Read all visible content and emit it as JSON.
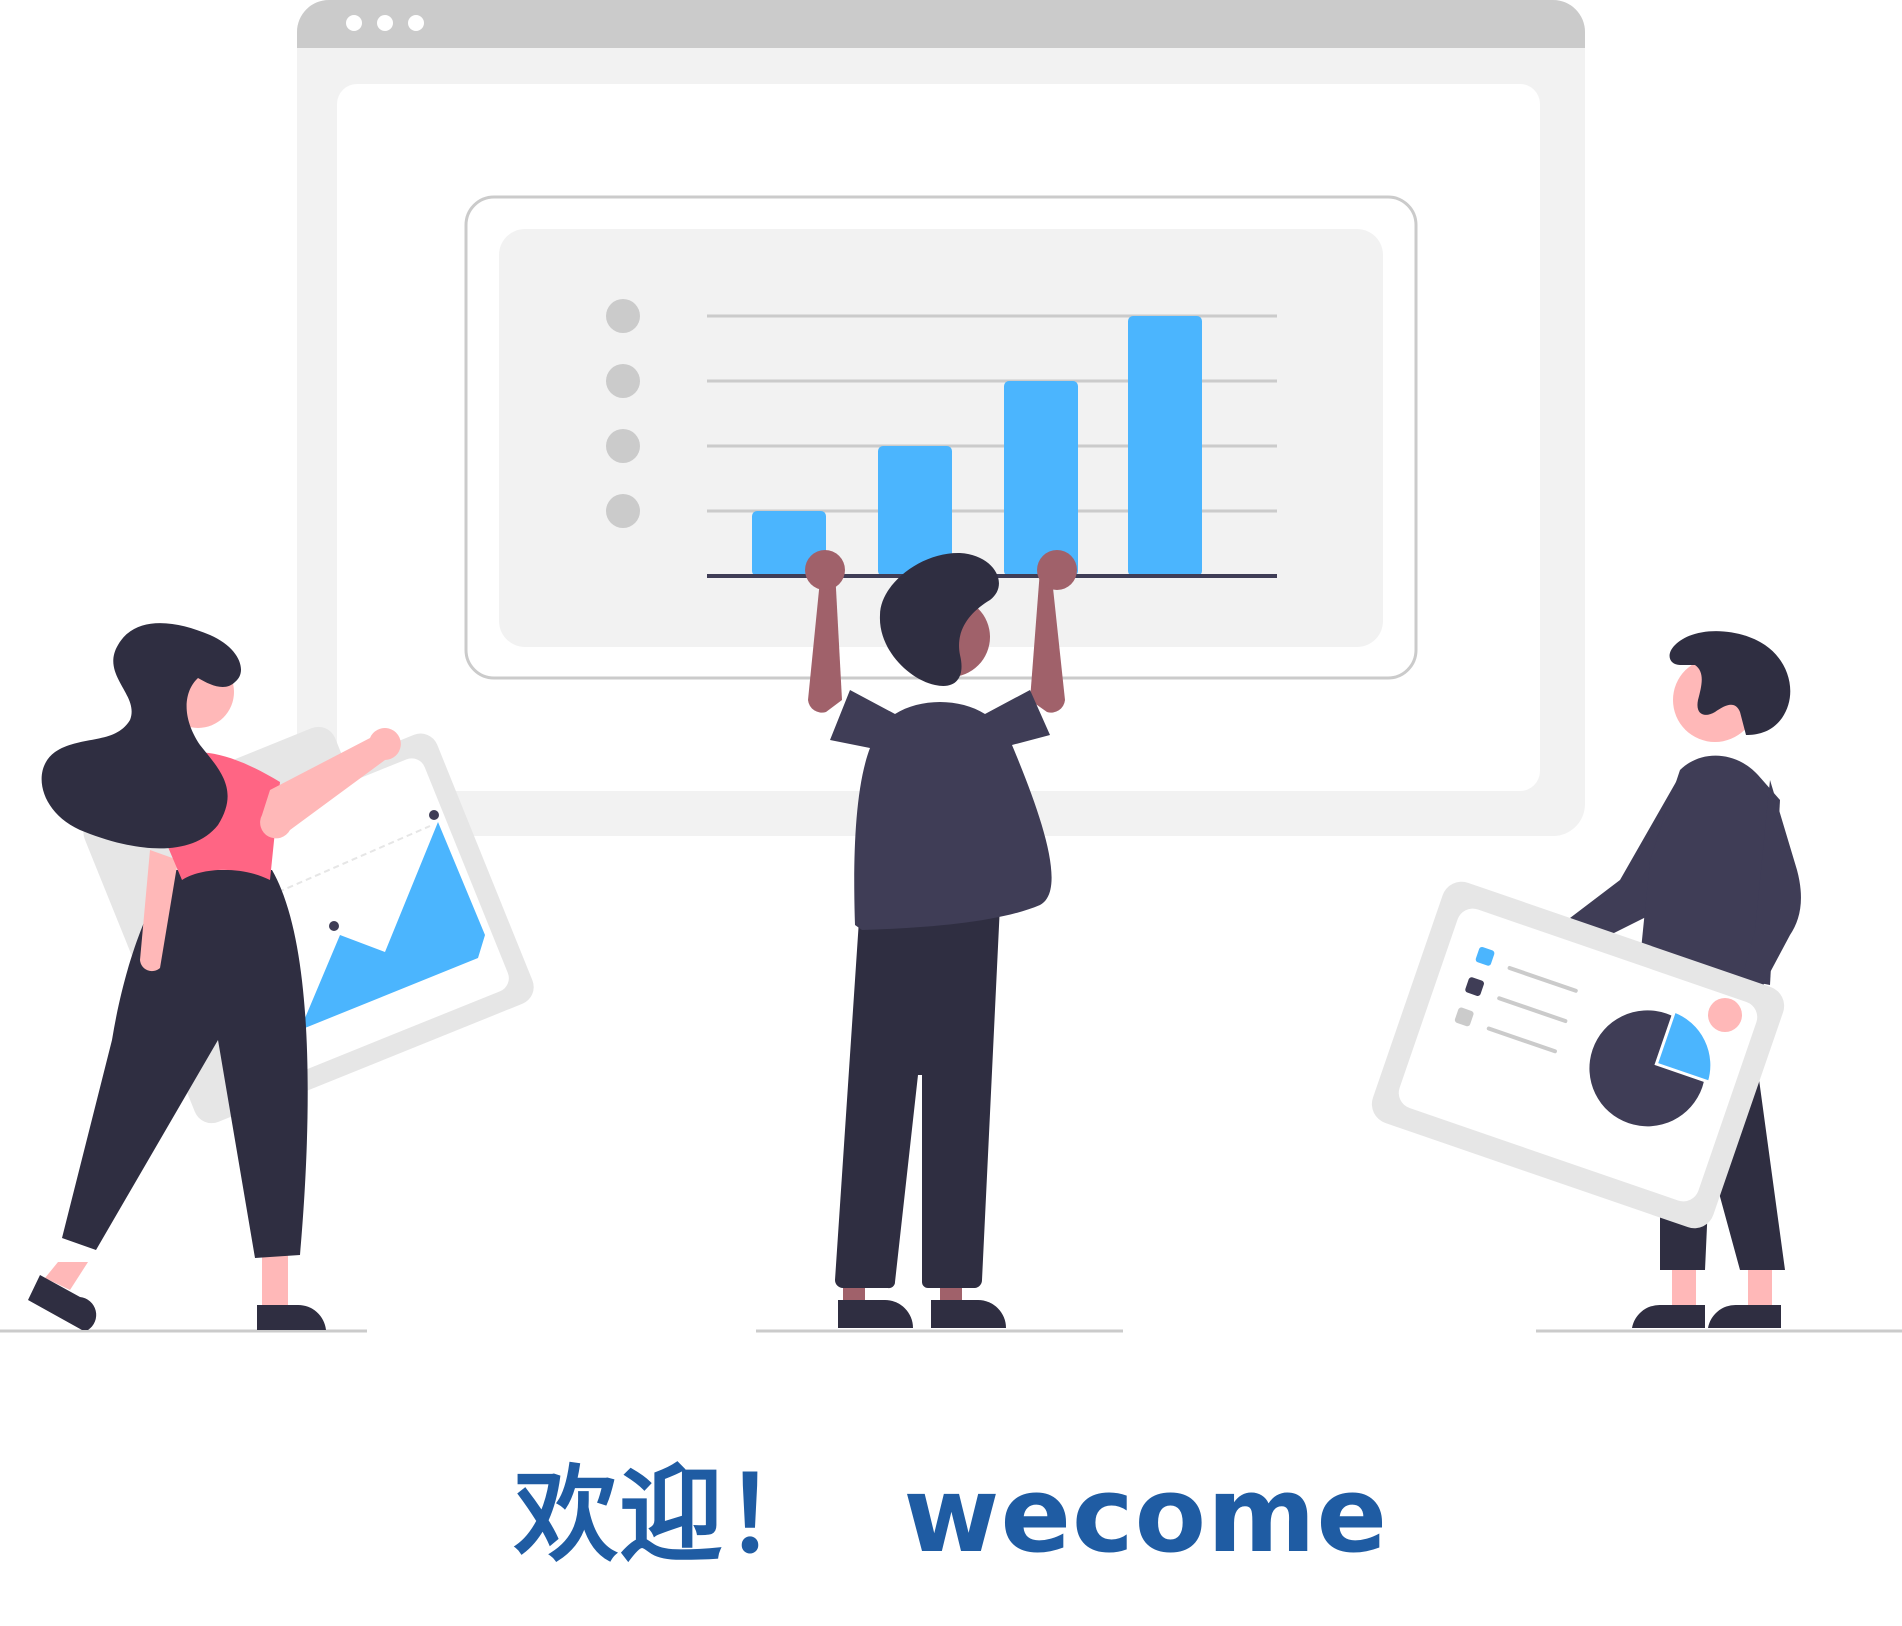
{
  "welcome": {
    "text": "欢迎！  wecome"
  },
  "colors": {
    "accent": "#4bb5fe",
    "window_frame": "#cbcbcb",
    "window_body": "#f2f2f2",
    "dark": "#2f2e41",
    "shirt": "#3f3d56",
    "skin_light": "#ffb8b8",
    "skin_dark": "#a0616a",
    "pink_top": "#ff6584",
    "heading": "#1f5ca3"
  },
  "illustration": {
    "scene": "data-dashboard-team",
    "icons": [
      "browser-window-icon",
      "bar-chart-icon",
      "area-chart-card-icon",
      "pie-chart-card-icon",
      "person-icon"
    ]
  },
  "chart_data": {
    "type": "bar",
    "categories": [
      "",
      "",
      "",
      ""
    ],
    "values": [
      1,
      2,
      3,
      4
    ],
    "title": "",
    "xlabel": "",
    "ylabel": "",
    "ylim": [
      0,
      4
    ],
    "grid": true
  }
}
